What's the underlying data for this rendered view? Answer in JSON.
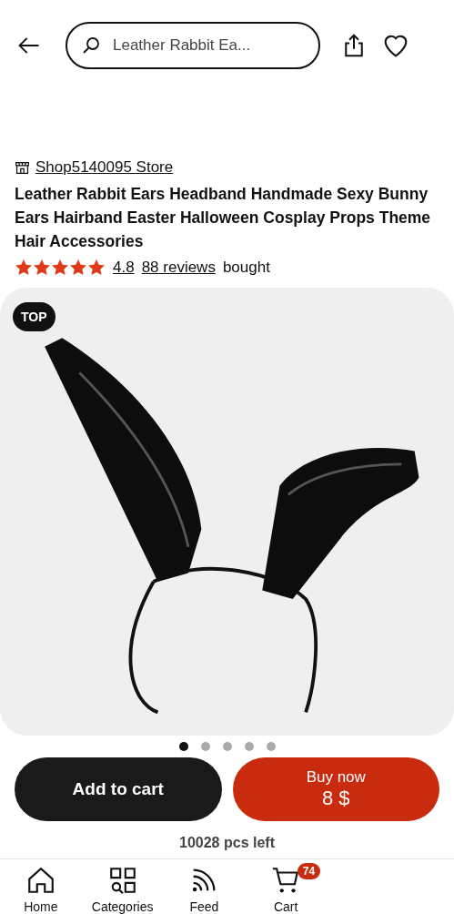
{
  "search": {
    "value": "Leather Rabbit Ea..."
  },
  "store": {
    "name": "Shop5140095 Store"
  },
  "product": {
    "title": "Leather Rabbit Ears Headband Handmade Sexy Bunny Ears Hairband Easter Halloween Cosplay Props Theme Hair Accessories",
    "stars": 5,
    "rating": "4.8",
    "reviews": "88 reviews",
    "bought": "bought"
  },
  "gallery": {
    "badge": "TOP",
    "dots": [
      {
        "selected": true
      },
      {
        "selected": false
      },
      {
        "selected": false
      },
      {
        "selected": false
      },
      {
        "selected": false
      }
    ]
  },
  "actions": {
    "add_to_cart": "Add to cart",
    "buy_now": "Buy now",
    "price": "8 $"
  },
  "stock": "10028 pcs left",
  "nav": [
    {
      "kind": "home",
      "label": "Home"
    },
    {
      "kind": "categories",
      "label": "Categories"
    },
    {
      "kind": "feed",
      "label": "Feed"
    },
    {
      "kind": "cart",
      "label": "Cart",
      "badge": "74"
    }
  ]
}
